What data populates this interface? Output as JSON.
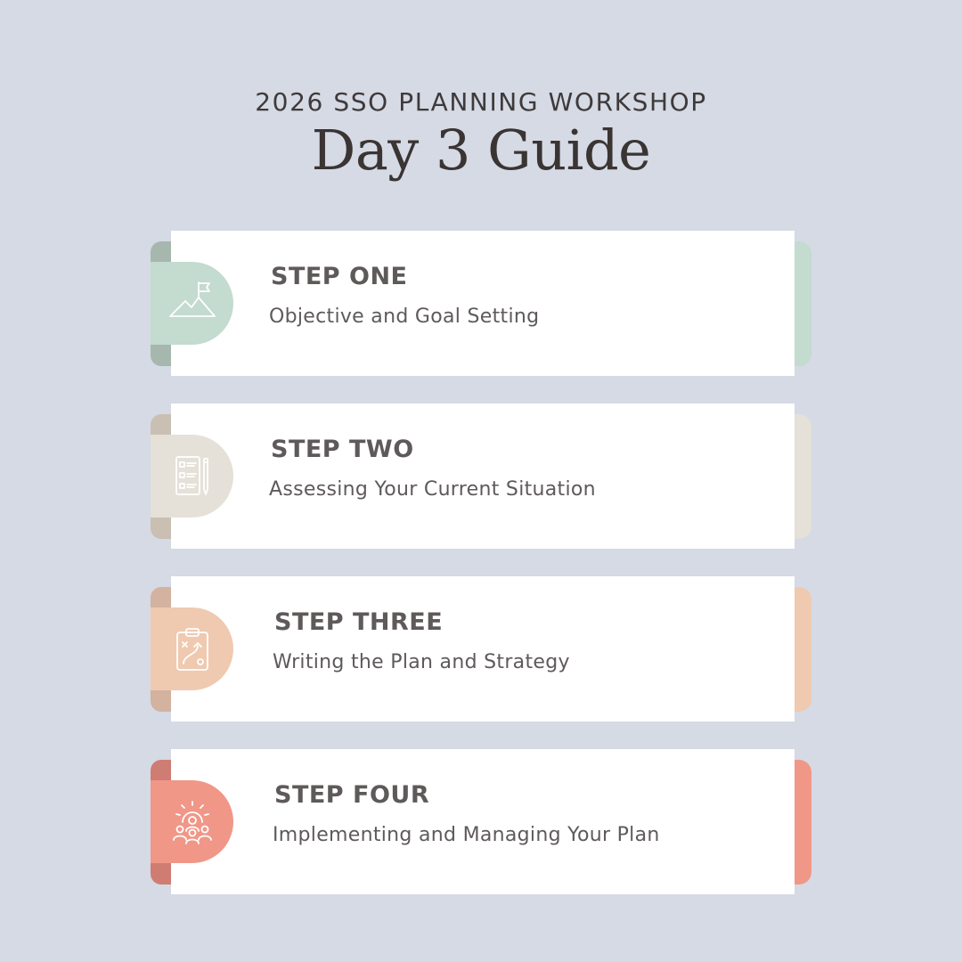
{
  "header": {
    "eyebrow": "2026 SSO PLANNING WORKSHOP",
    "title": "Day 3 Guide"
  },
  "colors": {
    "background": "#d5dae5",
    "panel": "#ffffff",
    "text": "#5f5a5a"
  },
  "steps": [
    {
      "title": "STEP ONE",
      "subtitle": "Objective and Goal Setting",
      "icon": "mountain-flag-icon",
      "color": "#c4dbcf",
      "color_dark": "#a6b8ae"
    },
    {
      "title": "STEP TWO",
      "subtitle": "Assessing Your Current Situation",
      "icon": "checklist-icon",
      "color": "#e5e1d8",
      "color_dark": "#c9bfb2"
    },
    {
      "title": "STEP THREE",
      "subtitle": "Writing the Plan and Strategy",
      "icon": "strategy-clipboard-icon",
      "color": "#efcab0",
      "color_dark": "#d3b29f"
    },
    {
      "title": "STEP FOUR",
      "subtitle": "Implementing and Managing Your Plan",
      "icon": "team-gear-icon",
      "color": "#f09788",
      "color_dark": "#cf7d73"
    }
  ]
}
